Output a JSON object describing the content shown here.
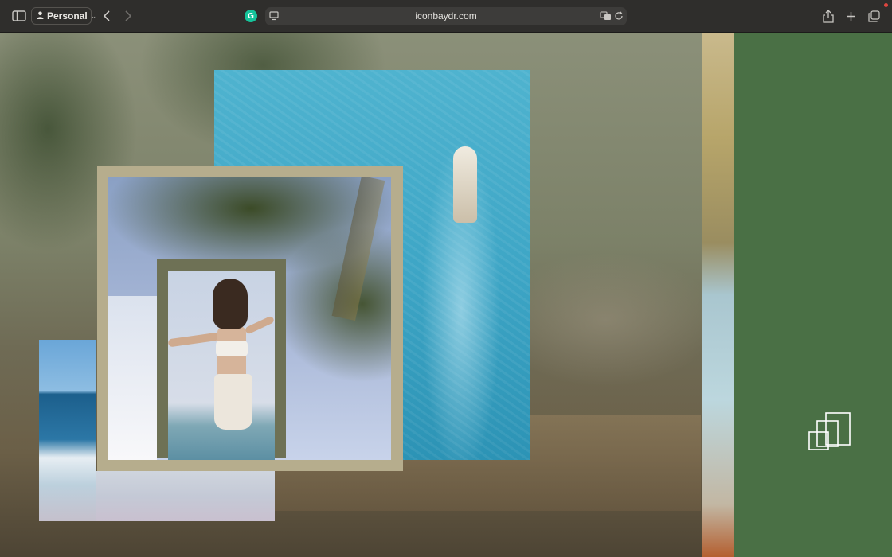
{
  "browser": {
    "profile_label": "Personal",
    "url": "iconbaydr.com",
    "grammarly_letter": "G"
  },
  "page": {
    "accent_green": "#4a7045",
    "photos": [
      {
        "name": "ocean-boat-photo",
        "subject": "aerial view of boat on blue water"
      },
      {
        "name": "palm-tree-photo",
        "subject": "palm fronds against sky"
      },
      {
        "name": "woman-photo",
        "subject": "woman in white outfit with arms outstretched"
      },
      {
        "name": "beach-waves-photo",
        "subject": "ocean waves on beach"
      }
    ],
    "logo_icon": "stacked-squares-logo-icon"
  }
}
